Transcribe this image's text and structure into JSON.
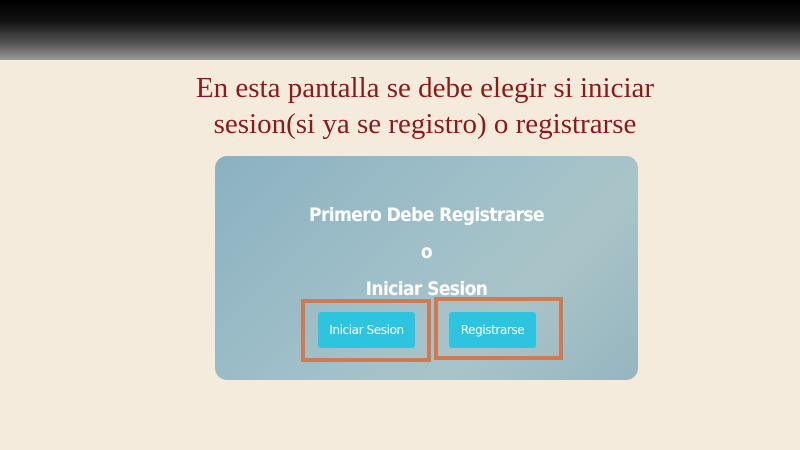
{
  "slide": {
    "heading_line1": "En esta pantalla se debe elegir si iniciar",
    "heading_line2": "sesion(si ya se registro) o registrarse"
  },
  "card": {
    "line1": "Primero Debe Registrarse",
    "line2": "o",
    "line3": "Iniciar Sesion"
  },
  "buttons": {
    "login_label": "Iniciar Sesion",
    "register_label": "Registrarse"
  },
  "colors": {
    "background": "#f5ebdc",
    "heading": "#8b1a1a",
    "button": "#2ec3df",
    "highlight_border": "#cf7a52",
    "card": "#9fbfc9"
  }
}
